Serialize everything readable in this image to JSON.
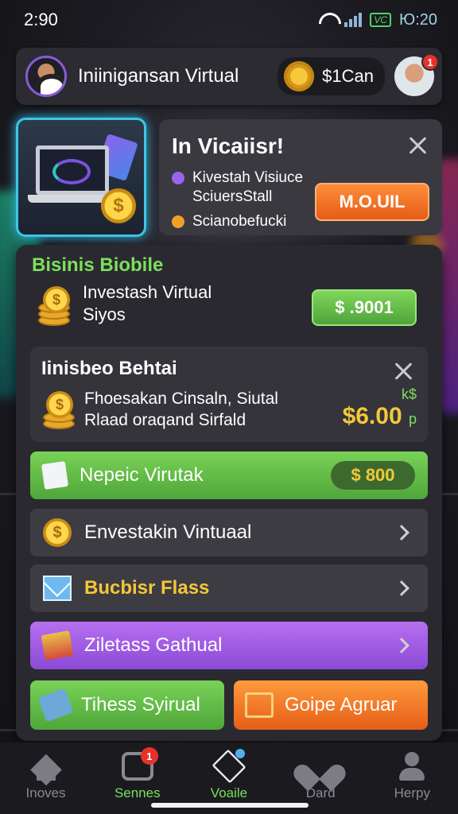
{
  "status_bar": {
    "time": "2:90",
    "battery_label": "VC",
    "clock_right": "Ю:20"
  },
  "header": {
    "title": "Iniinigansan Virtual",
    "coin_balance": "$1Can",
    "notification_count": "1"
  },
  "promo": {
    "title": "In Vicaiisr!",
    "bullets": [
      {
        "text": "Kivestah Visiuce\nSciuersStall",
        "color": "#9a63ec"
      },
      {
        "text": "Scianobefucki",
        "color": "#f0a02a"
      }
    ],
    "button_label": "M.O.UIL"
  },
  "section": {
    "title": "Bisinis Biobile",
    "offer_line1": "Investash Virtual",
    "offer_line2": "Siyos",
    "offer_button": "$ .9001"
  },
  "inner_card": {
    "title": "Iinisbeo Behtai",
    "line1": "Fhoesakan Cinsaln, Siutal",
    "line2": "Rlaad oraqand Sirfald",
    "price_small": "k$",
    "price_big": "$6.00",
    "price_suffix": "p"
  },
  "menu": [
    {
      "label": "Nepeic Virutak",
      "pill": "$ 800",
      "icon": "document-icon"
    },
    {
      "label": "Envestakin Vintuaal",
      "icon": "coin-icon"
    },
    {
      "label": "Bucbisr Flass",
      "icon": "mail-icon"
    },
    {
      "label": "Ziletass Gathual",
      "icon": "book-icon"
    }
  ],
  "bottom_buttons": [
    {
      "label": "Tihess Syirual",
      "icon": "box-icon"
    },
    {
      "label": "Goipe Agruar",
      "icon": "house-icon"
    }
  ],
  "coin_symbol": "$",
  "nav": [
    {
      "label": "Inoves",
      "icon": "home-icon"
    },
    {
      "label": "Sennes",
      "icon": "game-icon",
      "badge": "1"
    },
    {
      "label": "Voaile",
      "icon": "cube-icon"
    },
    {
      "label": "Dard",
      "icon": "heart-icon"
    },
    {
      "label": "Herpy",
      "icon": "user-icon"
    }
  ]
}
